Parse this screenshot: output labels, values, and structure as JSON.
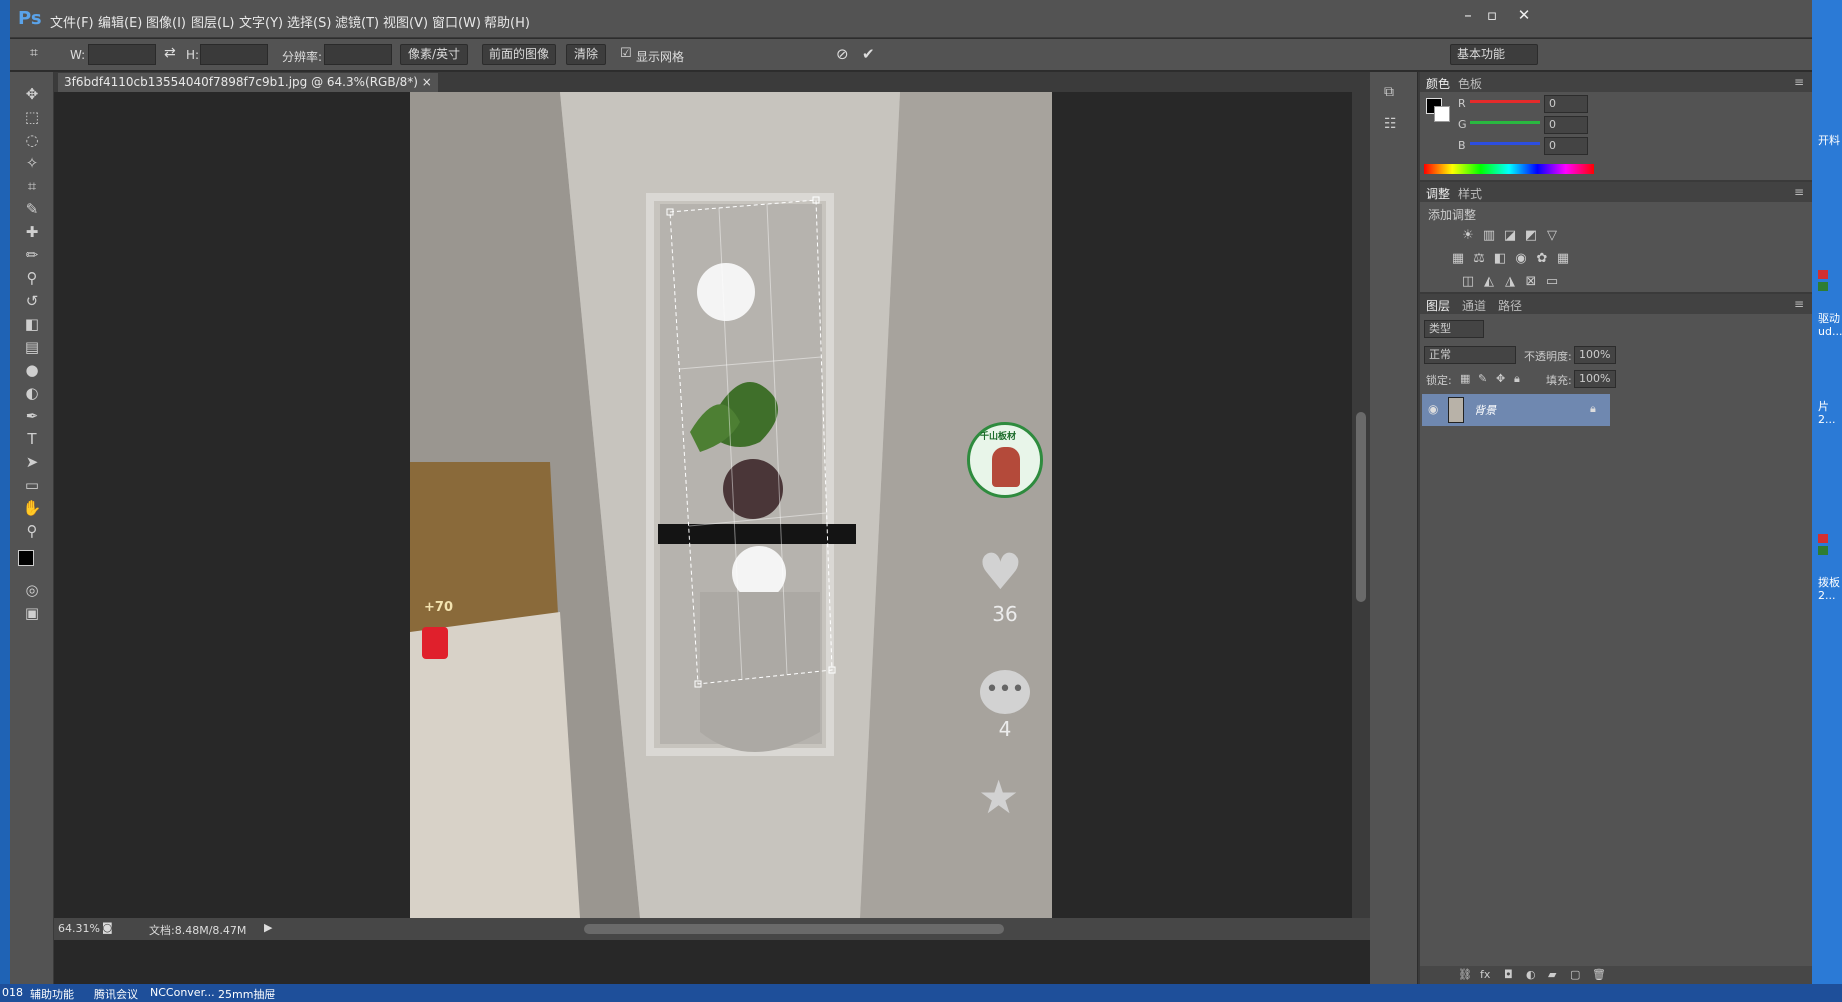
{
  "app": {
    "logo": "Ps",
    "menu": [
      "文件(F)",
      "编辑(E)",
      "图像(I)",
      "图层(L)",
      "文字(Y)",
      "选择(S)",
      "滤镜(T)",
      "视图(V)",
      "窗口(W)",
      "帮助(H)"
    ]
  },
  "options": {
    "w_label": "W:",
    "h_label": "H:",
    "resolution_label": "分辨率:",
    "unit": "像素/英寸",
    "front_image": "前面的图像",
    "clear": "清除",
    "show_grid": "显示网格",
    "workspace": "基本功能"
  },
  "document": {
    "tab": "3f6bdf4110cb13554040f7898f7c9b1.jpg @ 64.3%(RGB/8*)",
    "zoom": "64.31%",
    "doc_size": "文档:8.48M/8.47M"
  },
  "overlay": {
    "reward": "+70",
    "likes": "36",
    "comments": "4",
    "badge": "千山板材"
  },
  "panels": {
    "color": {
      "tabs": [
        "颜色",
        "色板"
      ],
      "channels": [
        {
          "name": "R",
          "value": "0",
          "color": "#e52b2b"
        },
        {
          "name": "G",
          "value": "0",
          "color": "#29b840"
        },
        {
          "name": "B",
          "value": "0",
          "color": "#2c4ee0"
        }
      ]
    },
    "adjust": {
      "tabs": [
        "调整",
        "样式"
      ],
      "title": "添加调整"
    },
    "layers": {
      "tabs": [
        "图层",
        "通道",
        "路径"
      ],
      "filter": "类型",
      "blend": "正常",
      "opacity_label": "不透明度:",
      "opacity": "100%",
      "lock_label": "锁定:",
      "fill_label": "填充:",
      "fill": "100%",
      "layer_name": "背景"
    }
  },
  "desktop": {
    "right": [
      "开料",
      "驱动 ud...",
      "片 2...",
      "拨板 2..."
    ],
    "taskbar": [
      "018",
      "辅助功能",
      "腾讯会议",
      "NCConver...",
      "25mm抽屉"
    ]
  }
}
